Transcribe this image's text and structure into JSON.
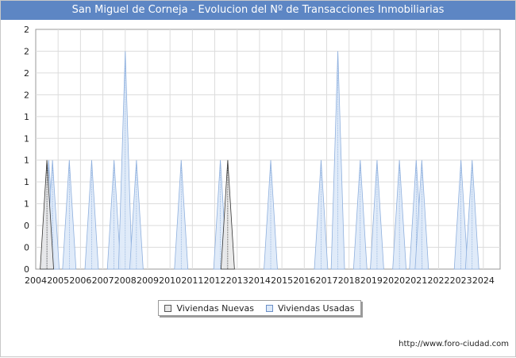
{
  "header": {
    "title": "San Miguel de Corneja - Evolucion del Nº de Transacciones Inmobiliarias"
  },
  "footer": {
    "url": "http://www.foro-ciudad.com"
  },
  "chart_data": {
    "type": "area",
    "x_ticks": [
      "2004",
      "2005",
      "2006",
      "2007",
      "2008",
      "2009",
      "2010",
      "2011",
      "2012",
      "2013",
      "2014",
      "2015",
      "2016",
      "2017",
      "2018",
      "2019",
      "2020",
      "2021",
      "2022",
      "2023",
      "2024"
    ],
    "y_ticks": [
      "0",
      "0",
      "0",
      "1",
      "1",
      "1",
      "1",
      "1",
      "2",
      "2",
      "2",
      "2"
    ],
    "ylim": [
      0,
      2.2
    ],
    "xlim": [
      2004.0,
      2024.75
    ],
    "grid": true,
    "legend_position": "bottom",
    "series": [
      {
        "name": "Viviendas Nuevas",
        "color": "#e8e8e8",
        "points": [
          {
            "x": 2004.5,
            "y": 1
          },
          {
            "x": 2012.58,
            "y": 1
          }
        ]
      },
      {
        "name": "Viviendas Usadas",
        "color": "#dde9f8",
        "points": [
          {
            "x": 2004.58,
            "y": 1
          },
          {
            "x": 2004.75,
            "y": 1
          },
          {
            "x": 2005.5,
            "y": 1
          },
          {
            "x": 2006.5,
            "y": 1
          },
          {
            "x": 2007.5,
            "y": 1
          },
          {
            "x": 2008.0,
            "y": 2
          },
          {
            "x": 2008.5,
            "y": 1
          },
          {
            "x": 2010.5,
            "y": 1
          },
          {
            "x": 2012.25,
            "y": 1
          },
          {
            "x": 2014.5,
            "y": 1
          },
          {
            "x": 2016.75,
            "y": 1
          },
          {
            "x": 2017.5,
            "y": 2
          },
          {
            "x": 2018.5,
            "y": 1
          },
          {
            "x": 2019.25,
            "y": 1
          },
          {
            "x": 2020.25,
            "y": 1
          },
          {
            "x": 2021.0,
            "y": 1
          },
          {
            "x": 2021.25,
            "y": 1
          },
          {
            "x": 2023.0,
            "y": 1
          },
          {
            "x": 2023.5,
            "y": 1
          }
        ]
      }
    ]
  },
  "legend": {
    "nuevas_label": "Viviendas Nuevas",
    "usadas_label": "Viviendas Usadas"
  }
}
